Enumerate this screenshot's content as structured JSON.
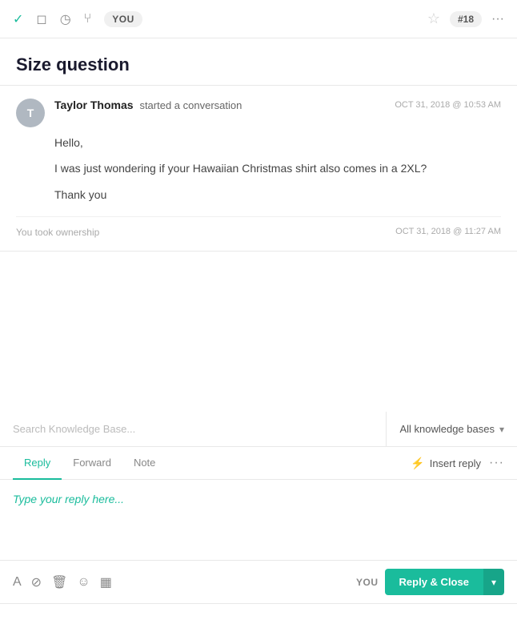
{
  "toolbar": {
    "user_label": "YOU",
    "ticket_number": "#18",
    "icons": {
      "check": "✓",
      "chat": "◻",
      "clock": "◷",
      "fork": "⑂",
      "star": "☆",
      "more": "···"
    }
  },
  "page": {
    "title": "Size question"
  },
  "conversation": {
    "sender": "Taylor Thomas",
    "action": "started a conversation",
    "avatar_letter": "T",
    "time": "OCT 31, 2018 @ 10:53 AM",
    "messages": [
      "Hello,",
      "I was just wondering if your Hawaiian Christmas shirt also comes in a 2XL?",
      "Thank you"
    ],
    "ownership_text": "You took ownership",
    "ownership_time": "OCT 31, 2018 @ 11:27 AM"
  },
  "knowledge_base": {
    "search_placeholder": "Search Knowledge Base...",
    "dropdown_label": "All knowledge bases",
    "dropdown_arrow": "▾"
  },
  "reply_area": {
    "tabs": [
      {
        "label": "Reply",
        "active": true
      },
      {
        "label": "Forward",
        "active": false
      },
      {
        "label": "Note",
        "active": false
      }
    ],
    "insert_reply_label": "Insert reply",
    "bolt_icon": "⚡",
    "more_dots": "···",
    "placeholder": "Type your reply here...",
    "icons": {
      "format": "A",
      "attach": "⊘",
      "delete": "🗑",
      "emoji": "☺",
      "kb": "▦"
    }
  },
  "reply_bottom": {
    "you_label": "YOU",
    "button_label": "Reply & Close",
    "dropdown_arrow": "▾"
  }
}
